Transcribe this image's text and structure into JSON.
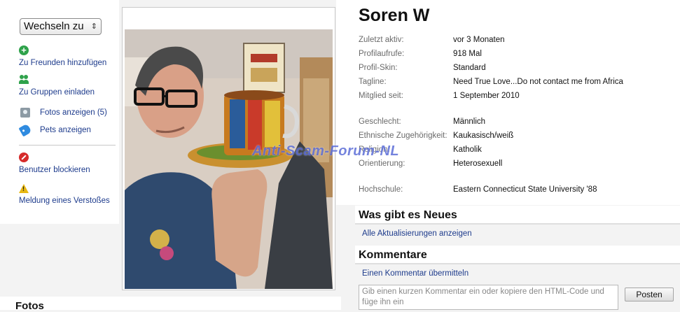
{
  "sidebar": {
    "switch_select": "Wechseln zu",
    "add_friend": "Zu Freunden hinzufügen",
    "invite_groups": "Zu Gruppen einladen",
    "view_photos": "Fotos anzeigen (5)",
    "view_pets": "Pets anzeigen",
    "block_user": "Benutzer blockieren",
    "report_abuse": "Meldung eines Verstoßes"
  },
  "profile": {
    "name": "Soren W",
    "fields": {
      "last_active": {
        "label": "Zuletzt aktiv:",
        "value": "vor 3 Monaten"
      },
      "views": {
        "label": "Profilaufrufe:",
        "value": "918 Mal"
      },
      "skin": {
        "label": "Profil-Skin:",
        "value": "Standard"
      },
      "tagline": {
        "label": "Tagline:",
        "value": "Need True Love...Do not contact me from Africa"
      },
      "member_since": {
        "label": "Mitglied seit:",
        "value": "1 September 2010"
      },
      "gender": {
        "label": "Geschlecht:",
        "value": "Männlich"
      },
      "ethnicity": {
        "label": "Ethnische Zugehörigkeit:",
        "value": "Kaukasisch/weiß"
      },
      "religion": {
        "label": "Religion:",
        "value": "Katholik"
      },
      "orientation": {
        "label": "Orientierung:",
        "value": "Heterosexuell"
      },
      "college": {
        "label": "Hochschule:",
        "value": "Eastern Connecticut State University '88"
      }
    }
  },
  "watermark": "Anti-Scam-Forum-NL",
  "news": {
    "heading": "Was gibt es Neues",
    "link": "Alle Aktualisierungen anzeigen"
  },
  "comments": {
    "heading": "Kommentare",
    "link": "Einen Kommentar übermitteln",
    "placeholder": "Gib einen kurzen Kommentar ein oder kopiere den HTML-Code und füge ihn ein",
    "post_button": "Posten"
  },
  "photos_heading": "Fotos",
  "colors": {
    "link": "#1d3b8c",
    "watermark": "#4a5ad2"
  }
}
